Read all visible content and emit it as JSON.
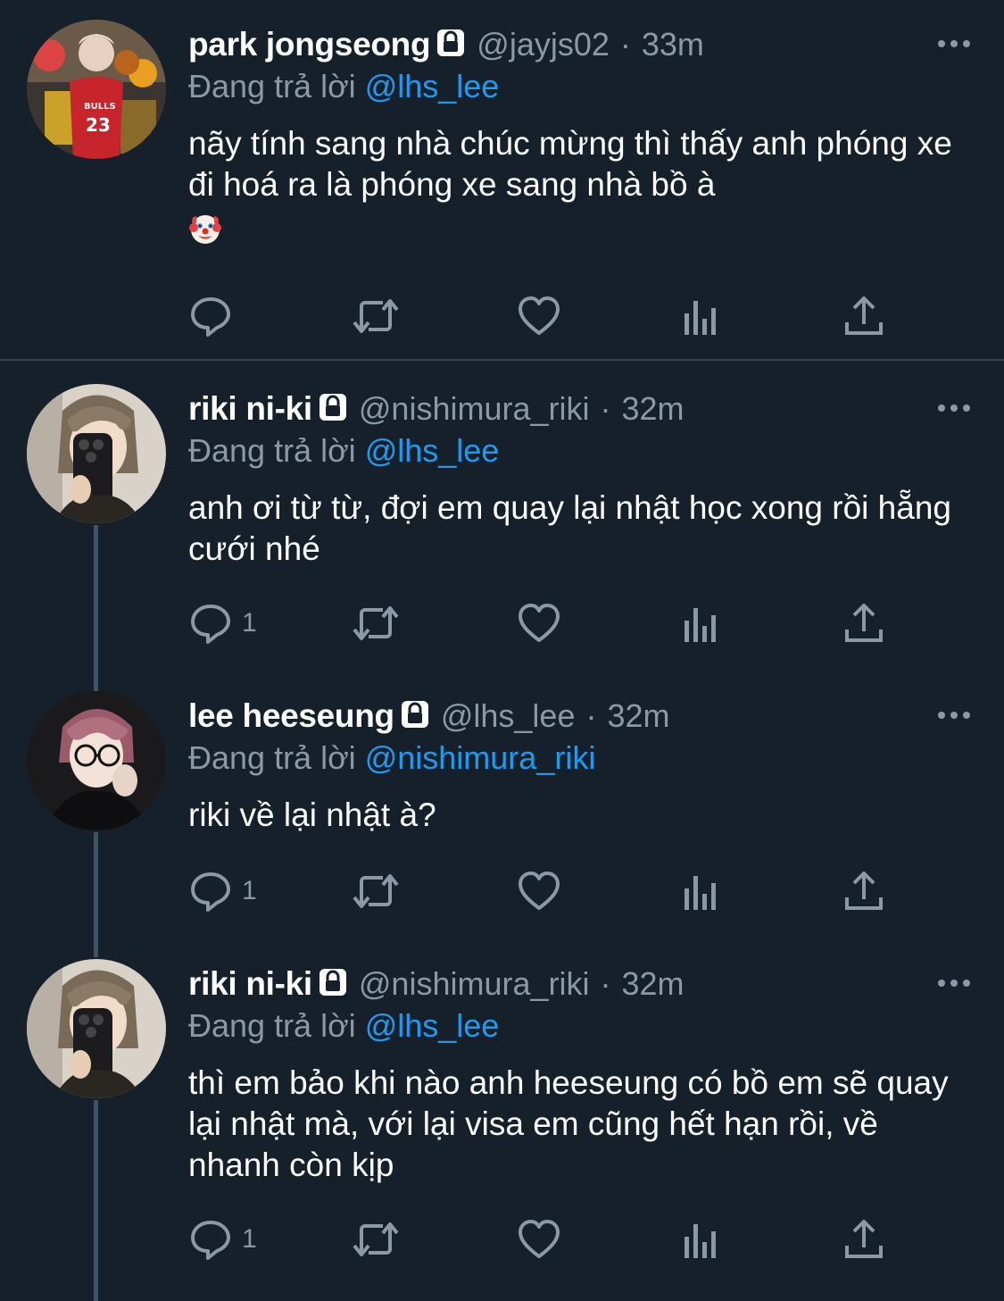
{
  "reply_prefix": "Đang trả lời",
  "tweets": [
    {
      "name": "park jongseong",
      "handle": "@jayjs02",
      "separator": "·",
      "time": "33m",
      "reply_to": "@lhs_lee",
      "text": "nãy tính sang nhà chúc mừng thì thấy anh phóng xe đi hoá ra là phóng xe sang nhà bồ à",
      "emoji": "clown-face",
      "reply_count": ""
    },
    {
      "name": "riki ni-ki",
      "handle": "@nishimura_riki",
      "separator": "·",
      "time": "32m",
      "reply_to": "@lhs_lee",
      "text": "anh ơi từ từ, đợi em quay lại nhật học xong rồi hẵng cưới nhé",
      "reply_count": "1"
    },
    {
      "name": "lee heeseung",
      "handle": "@lhs_lee",
      "separator": "·",
      "time": "32m",
      "reply_to": "@nishimura_riki",
      "text": "riki về lại nhật à?",
      "reply_count": "1"
    },
    {
      "name": "riki ni-ki",
      "handle": "@nishimura_riki",
      "separator": "·",
      "time": "32m",
      "reply_to": "@lhs_lee",
      "text": "thì em bảo khi nào anh heeseung có bồ em sẽ quay lại nhật mà, với lại visa em cũng hết hạn rồi, về nhanh còn kịp",
      "reply_count": "1"
    }
  ],
  "colors": {
    "background": "#15202b",
    "text_primary": "#ffffff",
    "text_secondary": "#8b98a5",
    "mention": "#1d9bf0",
    "separator": "#38444d",
    "thread_line": "#3d5466"
  }
}
